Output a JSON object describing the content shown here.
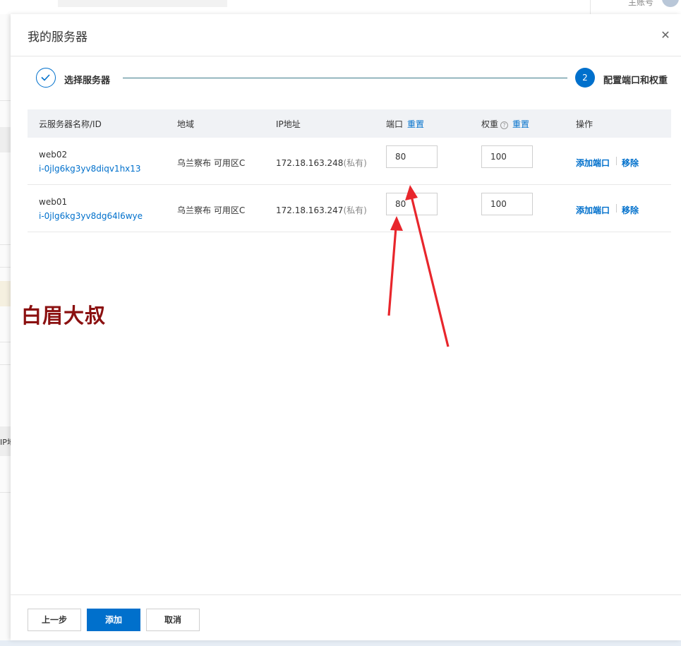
{
  "background": {
    "account_label": "主账号",
    "ip_header_fragment": "IP地"
  },
  "drawer": {
    "title": "我的服务器",
    "close_icon": "close-icon"
  },
  "steps": [
    {
      "label": "选择服务器",
      "status": "done",
      "icon": "check-icon"
    },
    {
      "number": "2",
      "label": "配置端口和权重",
      "status": "active"
    }
  ],
  "table": {
    "headers": {
      "name_id": "云服务器名称/ID",
      "region": "地域",
      "ip": "IP地址",
      "port": "端口",
      "port_reset": "重置",
      "weight": "权重",
      "weight_reset": "重置",
      "actions": "操作"
    },
    "rows": [
      {
        "name": "web02",
        "id": "i-0jlg6kg3yv8diqv1hx13",
        "region": "乌兰察布 可用区C",
        "ip": "172.18.163.248",
        "ip_type": "(私有)",
        "port": "80",
        "weight": "100",
        "add_port": "添加端口",
        "remove": "移除"
      },
      {
        "name": "web01",
        "id": "i-0jlg6kg3yv8dg64l6wye",
        "region": "乌兰察布 可用区C",
        "ip": "172.18.163.247",
        "ip_type": "(私有)",
        "port": "80",
        "weight": "100",
        "add_port": "添加端口",
        "remove": "移除"
      }
    ]
  },
  "watermark": "白眉大叔",
  "footer": {
    "prev": "上一步",
    "add": "添加",
    "cancel": "取消"
  },
  "colors": {
    "primary": "#0070cc",
    "arrow": "#e8262c",
    "watermark": "#8b1010"
  }
}
